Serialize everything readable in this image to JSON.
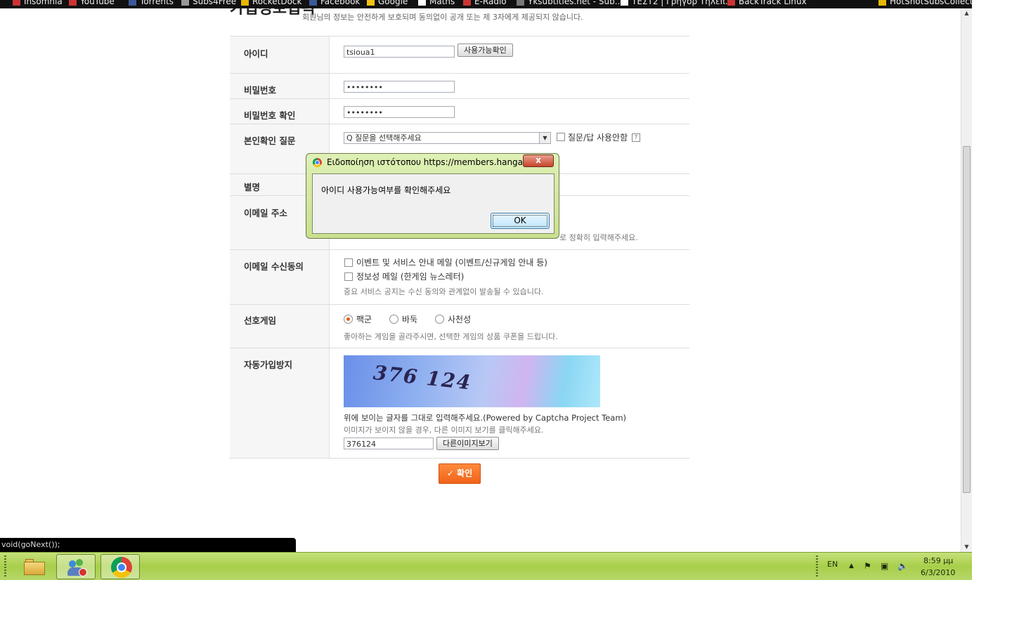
{
  "bookmarks": [
    "Insomnia",
    "YouTube",
    "Torrents",
    "Subs4Free",
    "RocketDock",
    "Facebook",
    "Google",
    "Maths",
    "E-Radio",
    "Yksubtitles.net - Sub...",
    "ΤΕΣΤ2 | Γρήγορ Τηλεπ...",
    "BackTrack Linux",
    "HotShotSubsCollecti..."
  ],
  "page": {
    "section_title": "가입정보입력",
    "privacy_note": "회원님의 정보는 안전하게 보호되며 동의없이 공개 또는 제 3자에게 제공되지 않습니다."
  },
  "form": {
    "id": {
      "label": "아이디",
      "value": "tsioua1",
      "check_button": "사용가능확인"
    },
    "password": {
      "label": "비밀번호",
      "value": "••••••••"
    },
    "password_confirm": {
      "label": "비밀번호 확인",
      "value": "••••••••"
    },
    "question": {
      "label": "본인확인 질문",
      "selected": "Q 질문을 선택해주세요",
      "no_question_label": "질문/답 사용안함",
      "help": "?"
    },
    "nickname": {
      "label": "별명"
    },
    "email": {
      "label": "이메일 주소",
      "note_tail": "로 정확히 입력해주세요."
    },
    "email_consent": {
      "label": "이메일 수신동의",
      "option1": "이벤트 및 서비스 안내 메일 (이벤트/신규게임 안내 등)",
      "option2": "정보성 메일 (한게임 뉴스레터)",
      "note": "중요 서비스 공지는 수신 동의와 관계없이 발송될 수 있습니다."
    },
    "favorite_game": {
      "label": "선호게임",
      "options": [
        "팩군",
        "바둑",
        "사천성"
      ],
      "selected": "팩군",
      "note": "좋아하는 게임을 골라주시면, 선택한 게임의 상품 쿠폰을 드립니다."
    },
    "captcha": {
      "label": "자동가입방지",
      "code_image_text": "376 124",
      "instruction": "위에 보이는 글자를 그대로 입력해주세요.(Powered by Captcha Project Team)",
      "instruction2": "이미지가 보이지 않을 경우, 다른 이미지 보기를 클릭해주세요.",
      "input_value": "376124",
      "other_image_button": "다른이미지보기"
    },
    "confirm_button": "✓ 확인"
  },
  "status_bar": "void(goNext());",
  "dialog": {
    "title": "Ειδοποίηση ιστότοπου https://members.hangame...",
    "close": "x",
    "message": "아이디 사용가능여부를 확인해주세요",
    "ok": "OK"
  },
  "taskbar": {
    "language": "EN",
    "time": "8:59 μμ",
    "date": "6/3/2010"
  },
  "colors": {
    "accent_orange": "#f0641a",
    "taskbar_green": "#a8cf4a",
    "dialog_green": "#c9e08e"
  },
  "icons": [
    "folder-icon",
    "people-stop-icon",
    "chrome-icon",
    "flag-icon",
    "network-icon",
    "volume-icon",
    "tray-arrow-icon"
  ]
}
